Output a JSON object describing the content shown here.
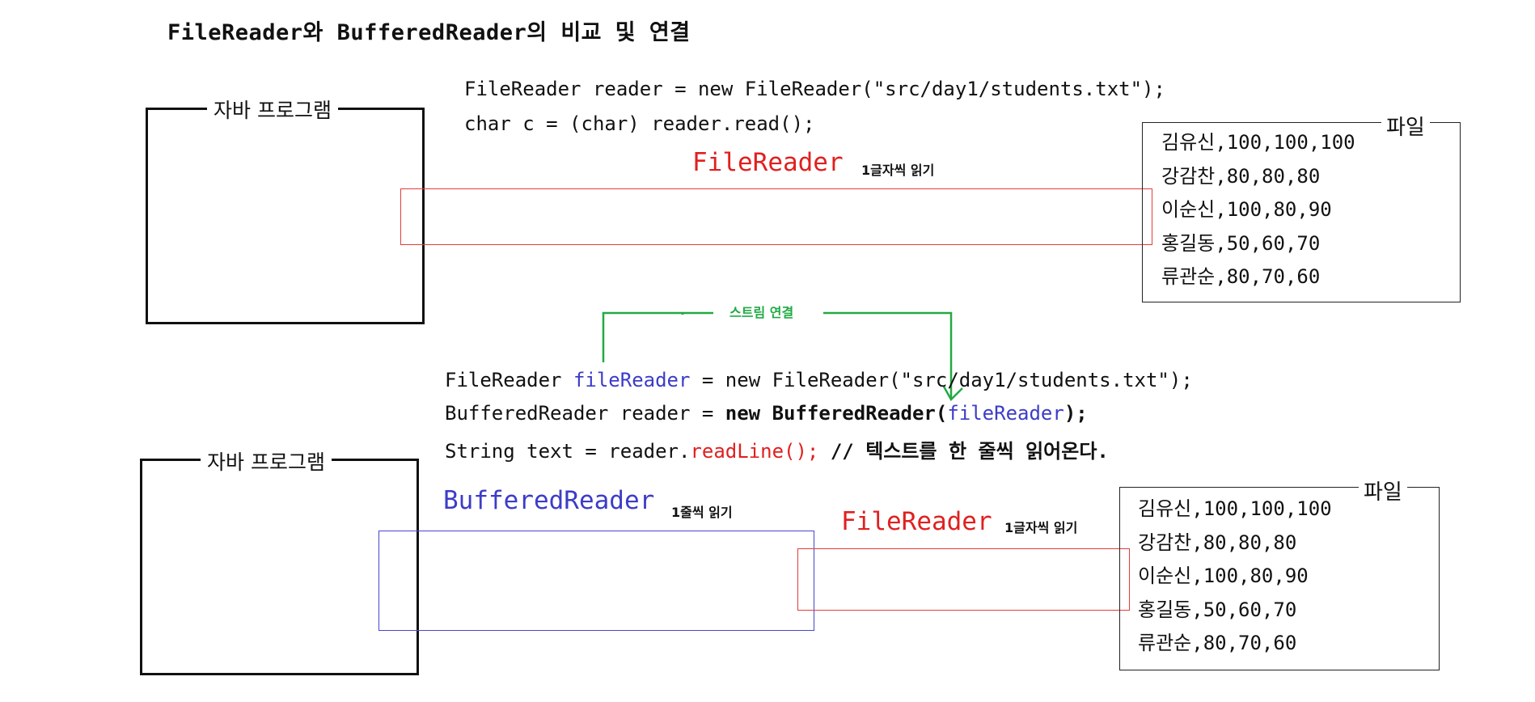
{
  "title": "FileReader와 BufferedReader의 비교 및 연결",
  "top": {
    "program_label": "자바 프로그램",
    "code": [
      "FileReader reader = new FileReader(\"src/day1/students.txt\");",
      "char c = (char) reader.read();"
    ],
    "stream_label": "FileReader",
    "stream_note": "1글자씩 읽기",
    "file_label": "파일",
    "file_lines": [
      "김유신,100,100,100",
      "강감찬,80,80,80",
      "이순신,100,80,90",
      "홍길동,50,60,70",
      "류관순,80,70,60"
    ]
  },
  "connector": {
    "label": "스트림 연결",
    "dot": "·"
  },
  "bottom": {
    "program_label": "자바 프로그램",
    "code_line1": {
      "a": "FileReader ",
      "var": "fileReader",
      "b": " = new FileReader(\"src/day1/students.txt\");"
    },
    "code_line2": {
      "a": "BufferedReader reader = ",
      "b": "new BufferedReader(",
      "var": "fileReader",
      "c": ");"
    },
    "code_line3": {
      "a": "String text = reader.",
      "method": "readLine();",
      "comment": " // 텍스트를 한 줄씩 읽어온다."
    },
    "outer_stream_label": "BufferedReader",
    "outer_stream_note": "1줄씩 읽기",
    "inner_stream_label": "FileReader",
    "inner_stream_note": "1글자씩 읽기",
    "file_label": "파일",
    "file_lines": [
      "김유신,100,100,100",
      "강감찬,80,80,80",
      "이순신,100,80,90",
      "홍길동,50,60,70",
      "류관순,80,70,60"
    ]
  },
  "colors": {
    "file_reader": "#e02020",
    "buffered_reader": "#3c3cc8",
    "connector": "#22aa44"
  }
}
